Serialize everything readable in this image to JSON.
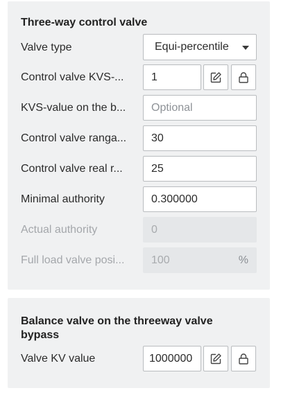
{
  "control_valve": {
    "title": "Three-way control valve",
    "valve_type": {
      "label": "Valve type",
      "value": "Equi-percentile"
    },
    "kvs": {
      "label": "Control valve KVS-...",
      "value": "1"
    },
    "kvs_bypass": {
      "label": "KVS-value on the b...",
      "placeholder": "Optional"
    },
    "rangeability": {
      "label": "Control valve ranga...",
      "value": "30"
    },
    "real_rangeability": {
      "label": "Control valve real r...",
      "value": "25"
    },
    "minimal_authority": {
      "label": "Minimal authority",
      "value": "0.300000"
    },
    "actual_authority": {
      "label": "Actual authority",
      "value": "0"
    },
    "full_load_position": {
      "label": "Full load valve posi...",
      "value": "100",
      "unit": "%"
    }
  },
  "balance_valve": {
    "title": "Balance valve on the threeway valve bypass",
    "kv": {
      "label": "Valve KV value",
      "value": "1000000"
    }
  },
  "icons": {
    "edit": "edit-pencil-icon",
    "lock": "lock-icon"
  }
}
